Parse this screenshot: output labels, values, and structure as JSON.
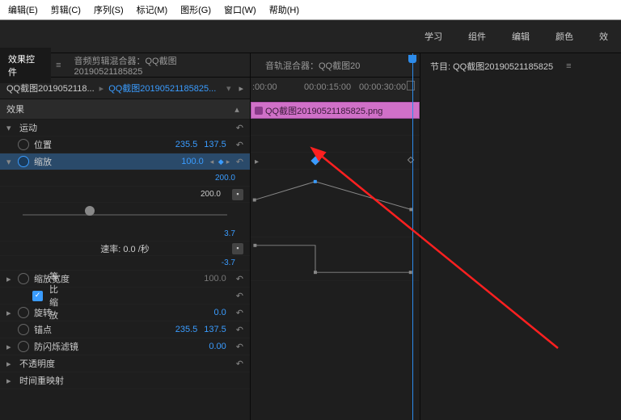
{
  "menu": {
    "edit": "编辑(E)",
    "clip": "剪辑(C)",
    "sequence": "序列(S)",
    "marker": "标记(M)",
    "graphics": "图形(G)",
    "window": "窗口(W)",
    "help": "帮助(H)"
  },
  "workspace": {
    "learn": "学习",
    "assembly": "组件",
    "edit": "编辑",
    "color": "颜色",
    "eff": "效"
  },
  "panels": {
    "effectControls": "效果控件",
    "audioClipMixer": "音频剪辑混合器：QQ截图20190521185825",
    "audioTrackMixer": "音轨混合器：QQ截图20"
  },
  "breadcrumb": {
    "clip": "QQ截图2019052118...",
    "seq": "QQ截图20190521185825..."
  },
  "sections": {
    "effects": "效果",
    "motion": "运动"
  },
  "props": {
    "position": {
      "label": "位置",
      "x": "235.5",
      "y": "137.5"
    },
    "scale": {
      "label": "缩放",
      "v": "100.0"
    },
    "scaleCeil": "200.0",
    "scaleCeilLabel": "200.0",
    "rate": "速率: 0.0 /秒",
    "rateMax": "3.7",
    "rateMin": "-3.7",
    "scaleW": {
      "label": "缩放宽度",
      "v": "100.0"
    },
    "uniform": "等比缩放",
    "rotation": {
      "label": "旋转",
      "v": "0.0"
    },
    "anchor": {
      "label": "锚点",
      "x": "235.5",
      "y": "137.5"
    },
    "flicker": {
      "label": "防闪烁滤镜",
      "v": "0.00"
    },
    "opacity": "不透明度",
    "timeRemap": "时间重映射"
  },
  "timeline": {
    "t0": ":00:00",
    "t1": "00:00:15:00",
    "t2": "00:00:30:00"
  },
  "clip": {
    "name": "QQ截图20190521185825.png"
  },
  "program": {
    "label": "节目: QQ截图20190521185825"
  }
}
